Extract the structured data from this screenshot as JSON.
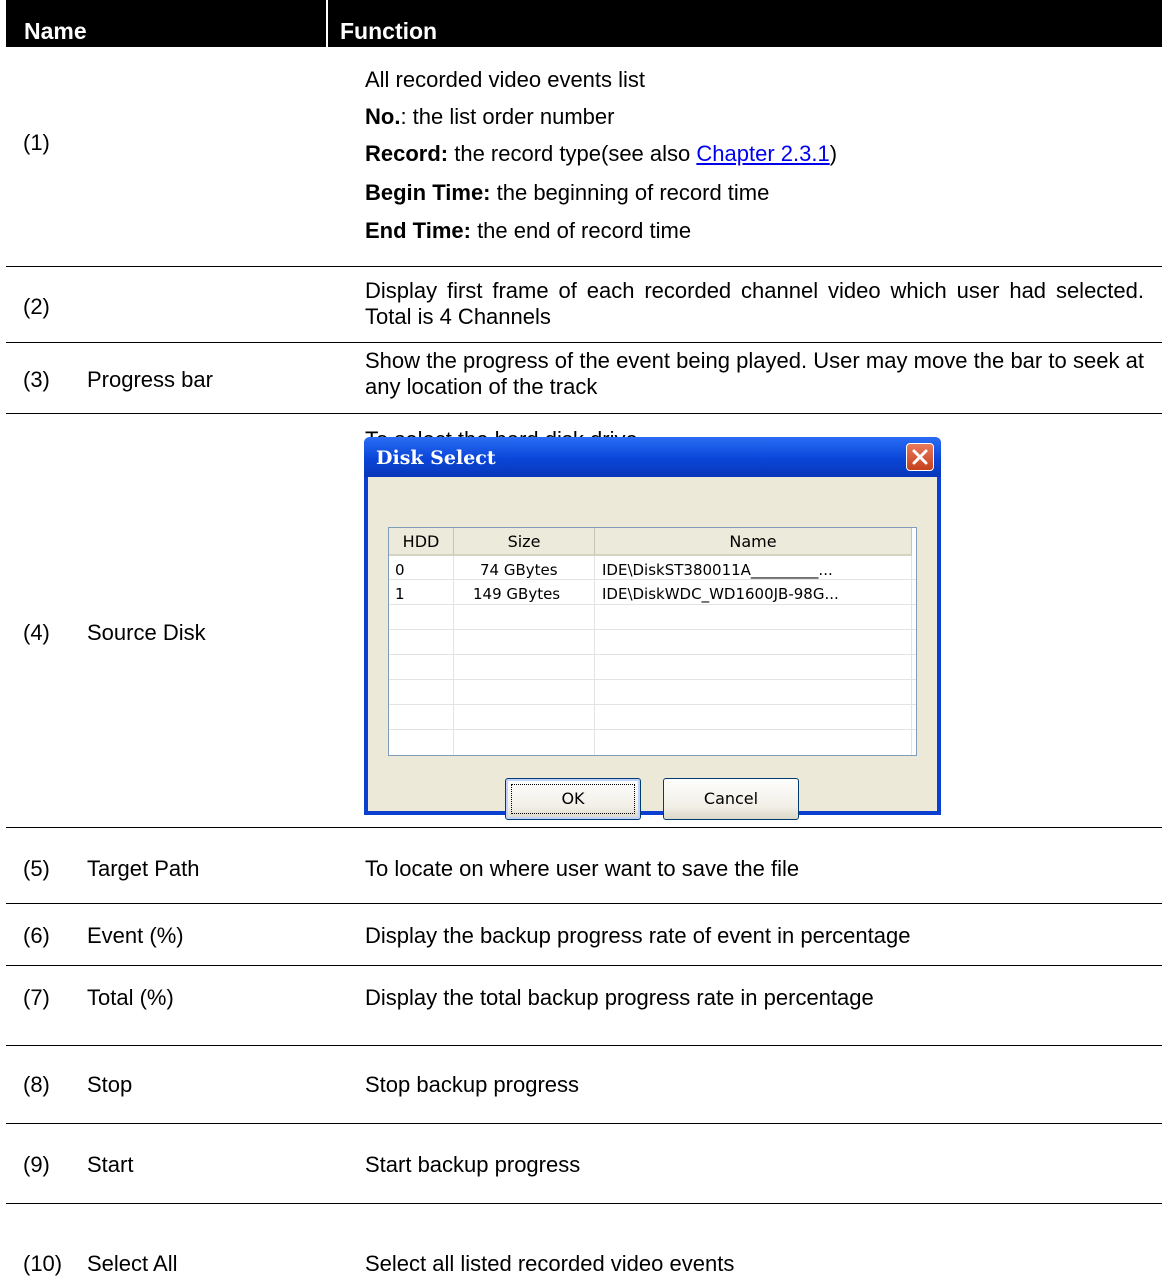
{
  "header": {
    "name": "Name",
    "function": "Function"
  },
  "rows": {
    "r1": {
      "num": "(1)",
      "lines": [
        {
          "bold": "",
          "text": "All recorded video events list"
        },
        {
          "bold": "No.",
          "text": ": the list order number"
        },
        {
          "bold": "Record:",
          "text": " the record type(see also ",
          "link": "Chapter 2.3.1",
          "tail": ")"
        },
        {
          "bold": "Begin Time:",
          "text": " the beginning of record time"
        },
        {
          "bold": "End Time:",
          "text": " the end of record time"
        }
      ]
    },
    "r2": {
      "num": "(2)",
      "name": "",
      "function": "Display first frame of each recorded channel video which user had selected. Total is 4 Channels"
    },
    "r3": {
      "num": "(3)",
      "name": "Progress bar",
      "function": "Show the progress of the event being played. User may move the bar to seek at any location of the track"
    },
    "r4": {
      "num": "(4)",
      "name": "Source Disk",
      "function": "To select the hard disk drive"
    },
    "r5": {
      "num": "(5)",
      "name": "Target Path",
      "function": "To locate on where user want to save the file"
    },
    "r6": {
      "num": "(6)",
      "name": "Event (%)",
      "function": "Display the backup progress rate of event in percentage"
    },
    "r7": {
      "num": "(7)",
      "name": "Total (%)",
      "function": "Display the total backup progress rate in percentage"
    },
    "r8": {
      "num": "(8)",
      "name": "Stop",
      "function": "Stop backup progress"
    },
    "r9": {
      "num": "(9)",
      "name": "Start",
      "function": "Start backup progress"
    },
    "r10": {
      "num": "(10)",
      "name": "Select All",
      "function": "Select all listed recorded video events"
    }
  },
  "dialog": {
    "title": "Disk Select",
    "columns": [
      "HDD",
      "Size",
      "Name"
    ],
    "items": [
      {
        "hdd": "0",
        "size": "74 GBytes",
        "name": "IDE\\DiskST380011A_________..."
      },
      {
        "hdd": "1",
        "size": "149 GBytes",
        "name": "IDE\\DiskWDC_WD1600JB-98G..."
      }
    ],
    "ok": "OK",
    "cancel": "Cancel"
  }
}
